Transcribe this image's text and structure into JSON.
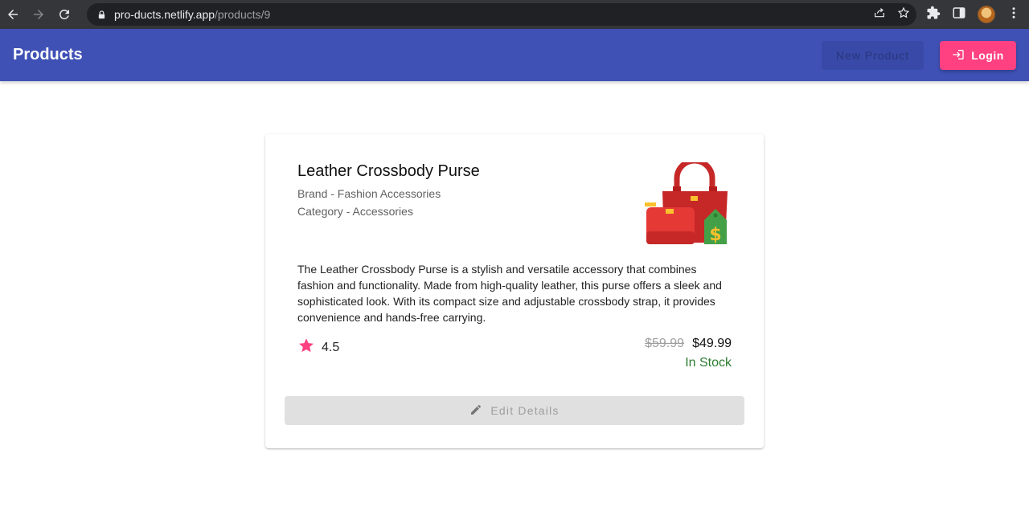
{
  "browser": {
    "url_host": "pro-ducts.netlify.app",
    "url_path": "/products/9"
  },
  "appbar": {
    "title": "Products",
    "new_product_label": "New Product",
    "login_label": "Login"
  },
  "product": {
    "title": "Leather Crossbody Purse",
    "brand": "Brand - Fashion Accessories",
    "category": "Category - Accessories",
    "description": "The Leather Crossbody Purse is a stylish and versatile accessory that combines fashion and functionality. Made from high-quality leather, this purse offers a sleek and sophisticated look. With its compact size and adjustable crossbody strap, it provides convenience and hands-free carrying.",
    "rating": "4.5",
    "old_price": "$59.99",
    "price": "$49.99",
    "stock": "In Stock",
    "edit_label": "Edit Details"
  },
  "colors": {
    "appbar": "#3f51b5",
    "accent": "#ff4081",
    "in_stock": "#2e7d32"
  }
}
